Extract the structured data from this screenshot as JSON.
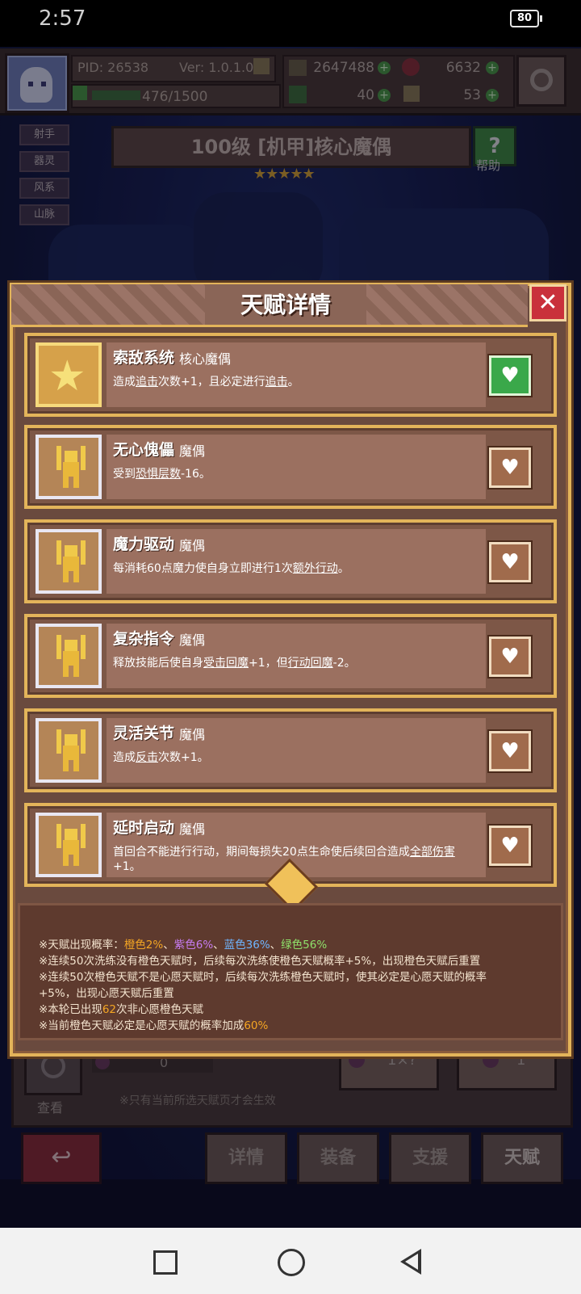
{
  "status_bar": {
    "time": "2:57",
    "battery": "80"
  },
  "hud": {
    "pid": "PID: 26538",
    "version": "Ver: 1.0.1.0",
    "gold": "2647488",
    "gems": "6632",
    "exp": "476/1500",
    "clover": "40",
    "item": "53"
  },
  "side_tags": [
    "射手",
    "器灵",
    "风系",
    "山脉"
  ],
  "banner": {
    "title": "100级 [机甲]核心魔偶",
    "stars": "★★★★★",
    "help_label": "帮助"
  },
  "modal": {
    "title": "天赋详情",
    "close": "✕",
    "talents": [
      {
        "name": "索敌系统",
        "type": "核心魔偶",
        "desc_parts": [
          "造成",
          "追击",
          "次数+1，且必定进行",
          "追击",
          "。"
        ],
        "liked": true,
        "icon": "star-icon"
      },
      {
        "name": "无心傀儡",
        "type": "魔偶",
        "desc_parts": [
          "受到",
          "恐惧层数",
          "-16。"
        ],
        "liked": false,
        "icon": "doll-icon"
      },
      {
        "name": "魔力驱动",
        "type": "魔偶",
        "desc_parts": [
          "每消耗60点魔力使自身立即进行1次",
          "额外行动",
          "。"
        ],
        "liked": false,
        "icon": "doll-icon"
      },
      {
        "name": "复杂指令",
        "type": "魔偶",
        "desc_parts": [
          "释放技能后使自身",
          "受击回魔",
          "+1，但",
          "行动回魔",
          "-2。"
        ],
        "liked": false,
        "icon": "doll-icon"
      },
      {
        "name": "灵活关节",
        "type": "魔偶",
        "desc_parts": [
          "造成",
          "反击",
          "次数+1。"
        ],
        "liked": false,
        "icon": "doll-icon"
      },
      {
        "name": "延时启动",
        "type": "魔偶",
        "desc_parts": [
          "首回合不能进行行动，期间每损失20点生命使后续回合造成",
          "全部伤害",
          "+1。"
        ],
        "liked": false,
        "icon": "doll-icon"
      }
    ],
    "info": {
      "line1_prefix": "※天赋出现概率：",
      "orange": "橙色2%",
      "sep1": "、",
      "purple": "紫色6%",
      "sep2": "、",
      "blue": "蓝色36%",
      "sep3": "、",
      "green": "绿色56%",
      "line2": "※连续50次洗练没有橙色天赋时，后续每次洗练使橙色天赋概率+5%，出现橙色天赋后重置",
      "line3": "※连续50次橙色天赋不是心愿天赋时，后续每次洗练橙色天赋时，使其必定是心愿天赋的概率",
      "line4": "+5%，出现心愿天赋后重置",
      "line5_prefix": "※本轮已出现",
      "line5_count": "62",
      "line5_suffix": "次非心愿橙色天赋",
      "line6_prefix": "※当前橙色天赋必定是心愿天赋的概率加成",
      "line6_value": "60%"
    }
  },
  "lower": {
    "view_label": "查看",
    "zero": "0",
    "note": "※只有当前所选天赋页才会生效",
    "wash_auto_val": "1×?",
    "wash_talent_val": "1"
  },
  "bottom_tabs": [
    "详情",
    "装备",
    "支援",
    "天赋"
  ],
  "colors": {
    "accent_gold": "#e3b45a",
    "close_red": "#c9303b",
    "liked_green": "#3aa84a"
  }
}
